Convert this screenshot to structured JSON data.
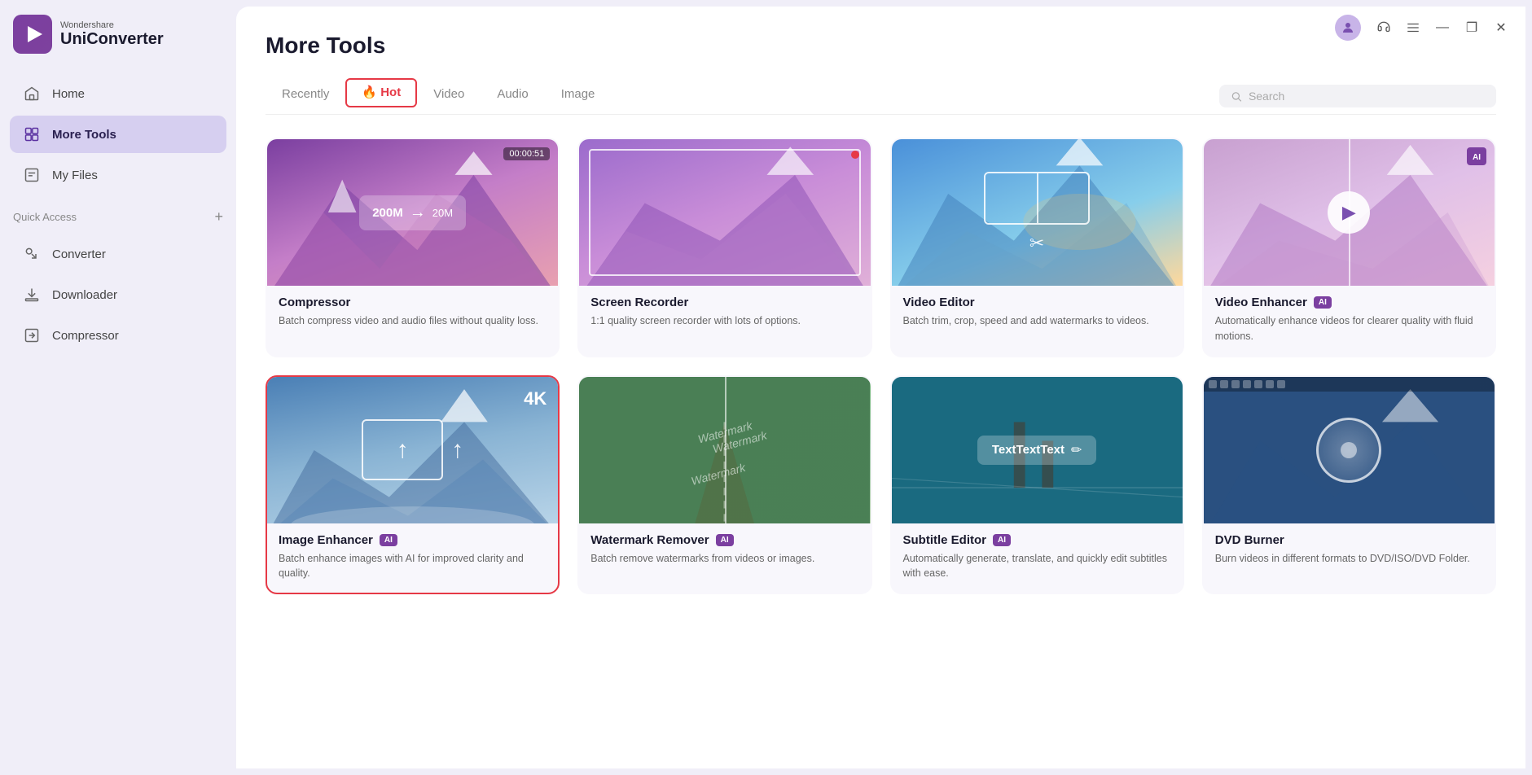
{
  "app": {
    "brand": "Wondershare",
    "name": "UniConverter"
  },
  "titlebar": {
    "minimize": "—",
    "restore": "❐",
    "close": "✕"
  },
  "sidebar": {
    "nav": [
      {
        "id": "home",
        "label": "Home",
        "icon": "home"
      },
      {
        "id": "more-tools",
        "label": "More Tools",
        "icon": "grid",
        "active": true
      },
      {
        "id": "my-files",
        "label": "My Files",
        "icon": "file"
      }
    ],
    "quick_access_label": "Quick Access",
    "quick_access_items": [
      {
        "id": "converter",
        "label": "Converter",
        "icon": "converter"
      },
      {
        "id": "downloader",
        "label": "Downloader",
        "icon": "downloader"
      },
      {
        "id": "compressor",
        "label": "Compressor",
        "icon": "compressor"
      }
    ]
  },
  "page": {
    "title": "More Tools",
    "tabs": [
      {
        "id": "recently",
        "label": "Recently"
      },
      {
        "id": "hot",
        "label": "Hot",
        "active": true
      },
      {
        "id": "video",
        "label": "Video"
      },
      {
        "id": "audio",
        "label": "Audio"
      },
      {
        "id": "image",
        "label": "Image"
      }
    ],
    "search_placeholder": "Search"
  },
  "tools": [
    {
      "id": "compressor",
      "name": "Compressor",
      "desc": "Batch compress video and audio files without quality loss.",
      "thumb": "compressor",
      "ai": false,
      "from_size": "200M",
      "to_size": "20M",
      "timestamp": "00:00:51"
    },
    {
      "id": "screen-recorder",
      "name": "Screen Recorder",
      "desc": "1:1 quality screen recorder with lots of options.",
      "thumb": "recorder",
      "ai": false
    },
    {
      "id": "video-editor",
      "name": "Video Editor",
      "desc": "Batch trim, crop, speed and add watermarks to videos.",
      "thumb": "editor",
      "ai": false
    },
    {
      "id": "video-enhancer",
      "name": "Video Enhancer",
      "desc": "Automatically enhance videos for clearer quality with fluid motions.",
      "thumb": "enhancer-video",
      "ai": true
    },
    {
      "id": "image-enhancer",
      "name": "Image Enhancer",
      "desc": "Batch enhance images with AI for improved clarity and quality.",
      "thumb": "image-enhancer",
      "ai": true,
      "selected": true
    },
    {
      "id": "watermark-remover",
      "name": "Watermark Remover",
      "desc": "Batch remove watermarks from videos or images.",
      "thumb": "watermark",
      "ai": true
    },
    {
      "id": "subtitle-editor",
      "name": "Subtitle Editor",
      "desc": "Automatically generate, translate, and quickly edit subtitles with ease.",
      "thumb": "subtitle",
      "ai": true
    },
    {
      "id": "dvd-burner",
      "name": "DVD Burner",
      "desc": "Burn videos in different formats to DVD/ISO/DVD Folder.",
      "thumb": "dvd",
      "ai": false
    }
  ]
}
